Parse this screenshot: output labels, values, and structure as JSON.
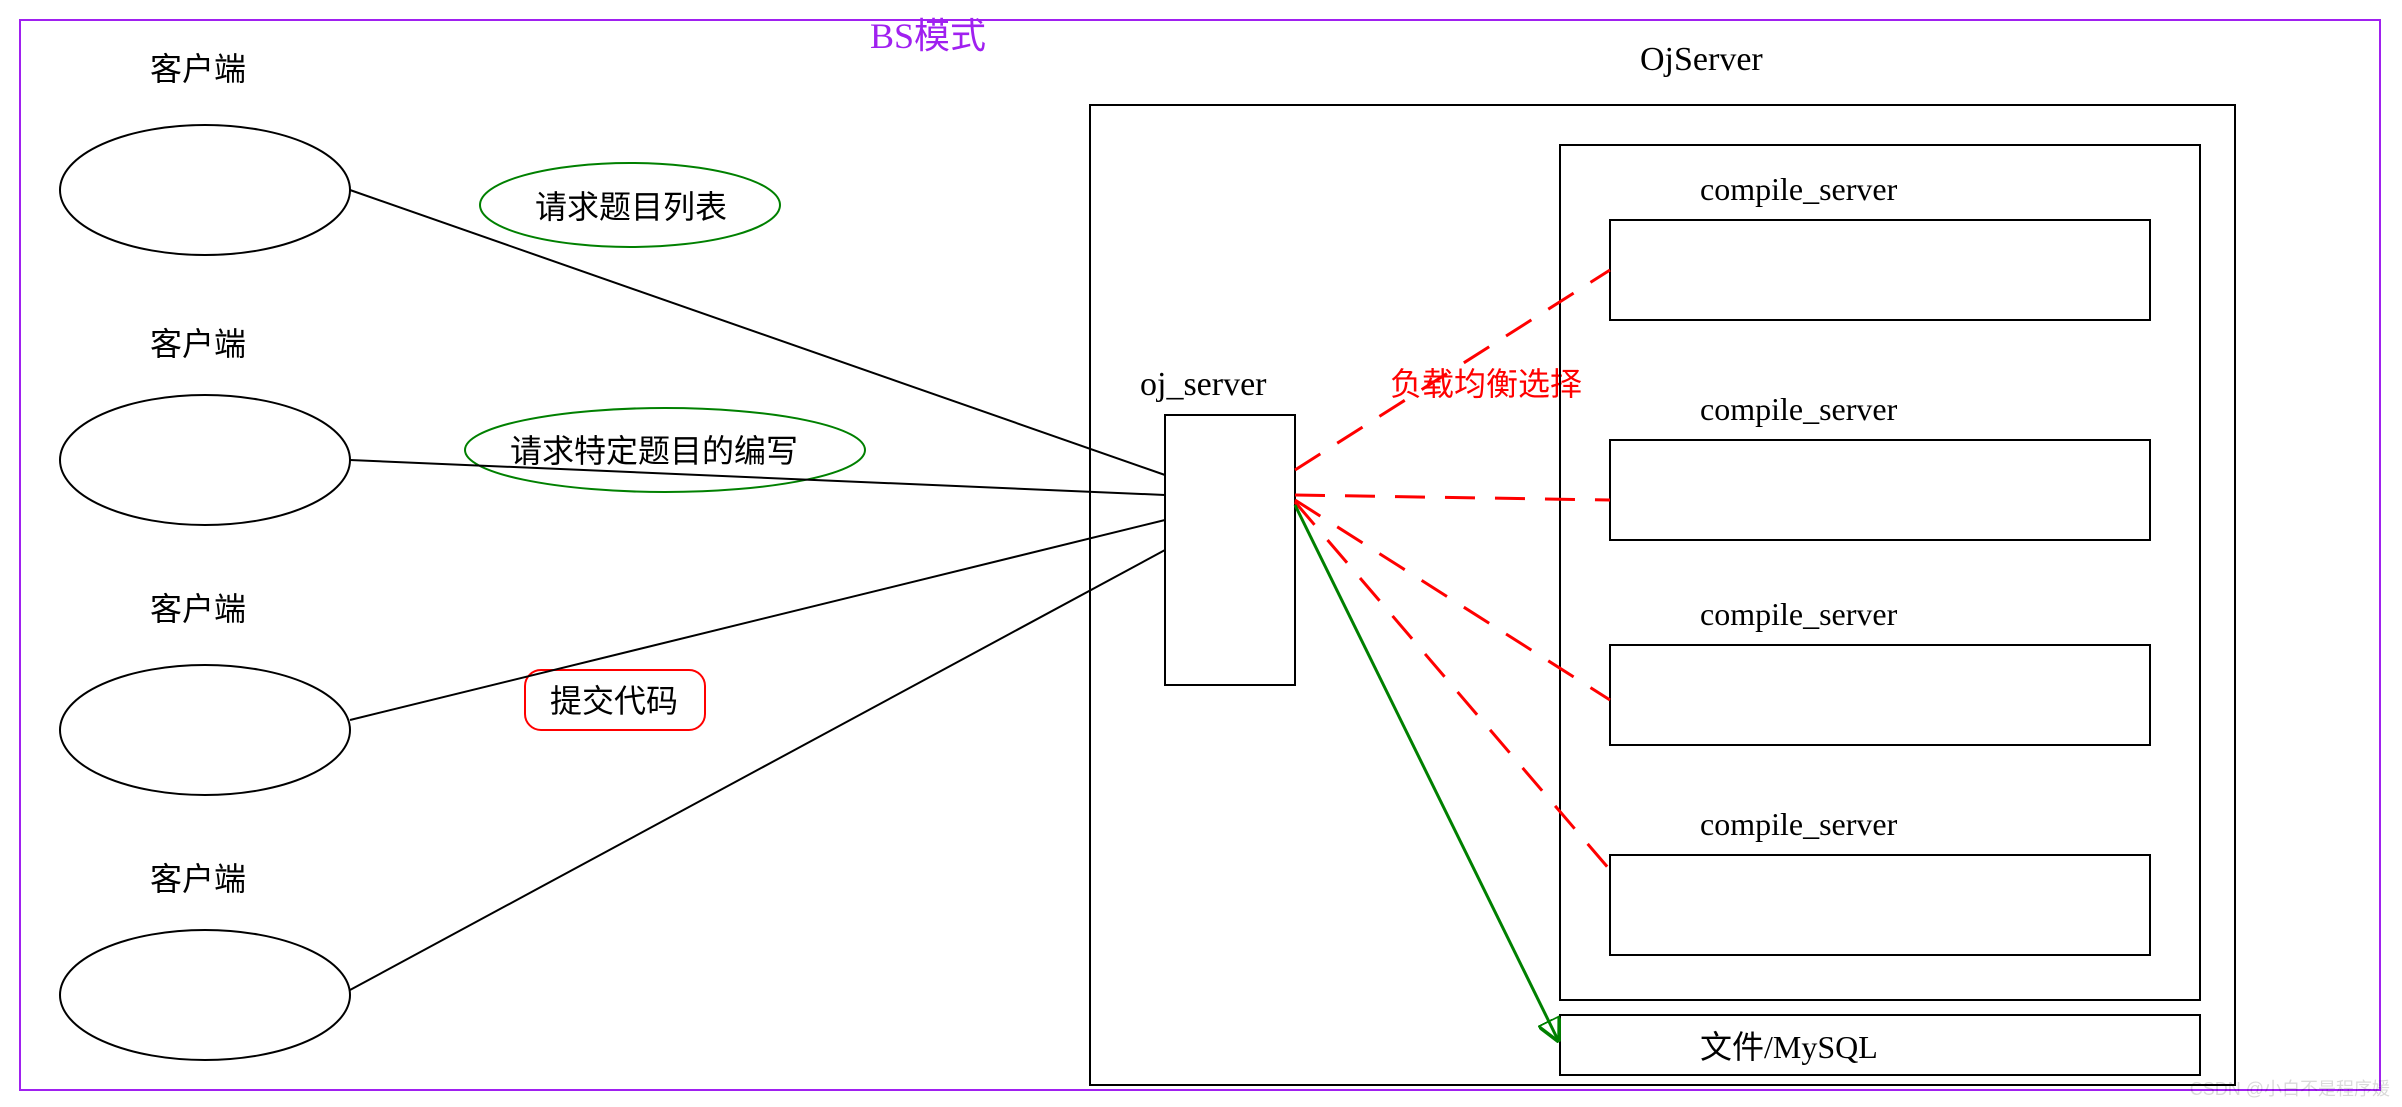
{
  "title": "BS模式",
  "clients": {
    "label": "客户端"
  },
  "requests": {
    "list": "请求题目列表",
    "detail": "请求特定题目的编写",
    "submit": "提交代码"
  },
  "server": {
    "oj_label": "oj_server",
    "group_label": "OjServer",
    "balance_label": "负载均衡选择",
    "compile_label": "compile_server",
    "storage_label": "文件/MySQL"
  },
  "watermark": "CSDN @小白不是程序媛",
  "colors": {
    "purple": "#a020f0",
    "green": "#008000",
    "red": "#ff0000"
  }
}
